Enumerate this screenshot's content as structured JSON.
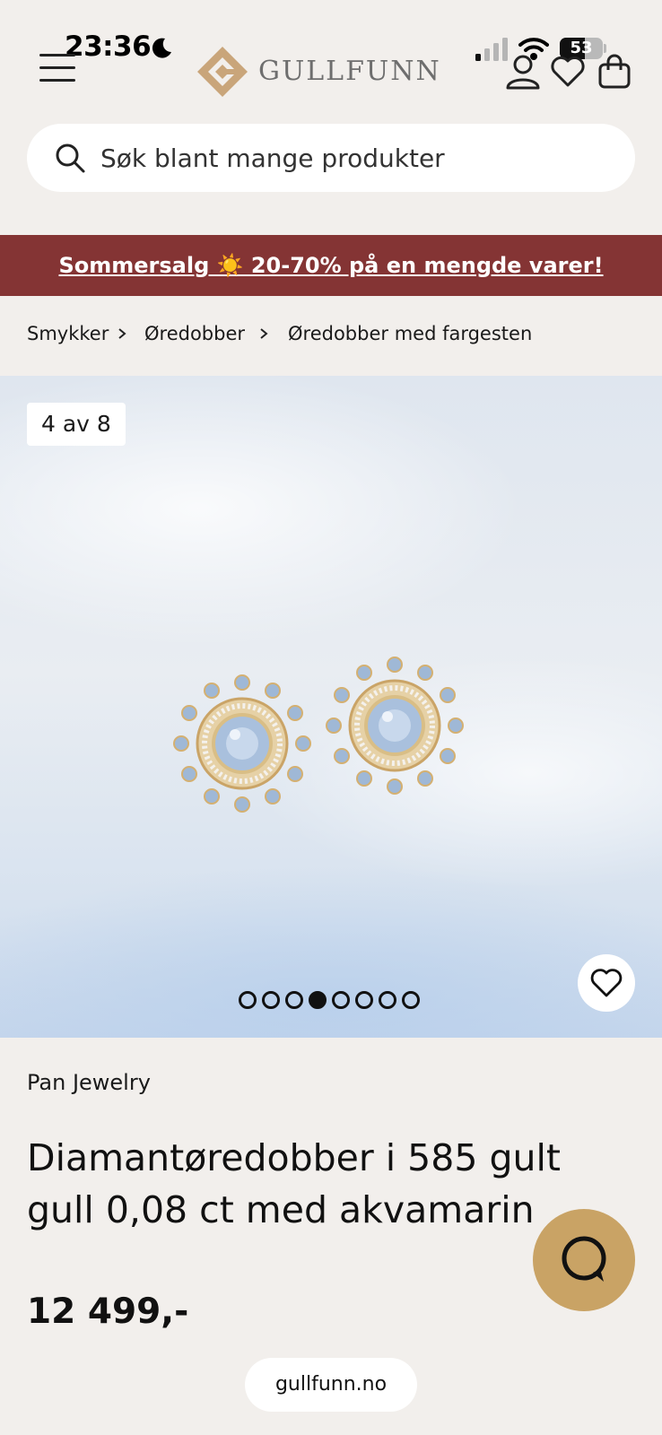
{
  "status_bar": {
    "time": "23:36",
    "battery_percent": "53",
    "icons": [
      "moon-icon",
      "signal-icon",
      "wifi-icon",
      "battery-icon"
    ]
  },
  "header": {
    "logo_text": "GULLFUNN",
    "icons": [
      "menu-icon",
      "account-icon",
      "wishlist-icon",
      "cart-icon"
    ]
  },
  "search": {
    "placeholder": "Søk blant mange produkter"
  },
  "banner": {
    "text": "Sommersalg ☀️ 20-70% på en mengde varer!",
    "background": "#843434"
  },
  "breadcrumb": {
    "items": [
      "Smykker",
      "Øredobber",
      "Øredobber med fargesten"
    ]
  },
  "gallery": {
    "counter": "4 av 8",
    "total": 8,
    "active_index": 3
  },
  "product": {
    "brand": "Pan Jewelry",
    "title": "Diamantøredobber i 585 gult gull 0,08 ct med akvamarin",
    "price": "12 499,-"
  },
  "browser": {
    "url": "gullfunn.no"
  },
  "colors": {
    "background": "#f2efec",
    "accent_gold": "#c9a365",
    "banner_red": "#843434"
  }
}
